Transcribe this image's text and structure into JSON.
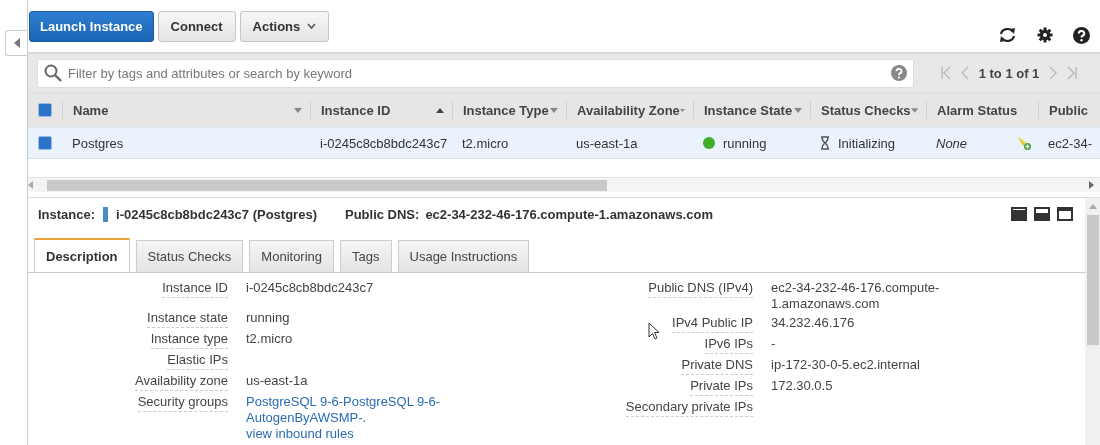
{
  "toolbar": {
    "buttons": [
      {
        "label": "Launch Instance",
        "kind": "primary"
      },
      {
        "label": "Connect",
        "kind": "default"
      },
      {
        "label": "Actions",
        "kind": "dropdown"
      }
    ]
  },
  "filter": {
    "placeholder": "Filter by tags and attributes or search by keyword"
  },
  "pager": {
    "label": "1 to 1 of 1"
  },
  "table": {
    "select_all": {
      "checked": true
    },
    "columns": [
      {
        "label": "Name",
        "kind": "menu"
      },
      {
        "label": "Instance ID",
        "kind": "asc"
      },
      {
        "label": "Instance Type",
        "kind": "menu"
      },
      {
        "label": "Availability Zone",
        "kind": "menu"
      },
      {
        "label": "Instance State",
        "kind": "menu"
      },
      {
        "label": "Status Checks",
        "kind": "menu"
      },
      {
        "label": "Alarm Status",
        "kind": "plain"
      },
      {
        "label": "Public",
        "kind": "plain"
      }
    ],
    "rows": [
      {
        "selected": true,
        "cells": [
          {
            "kind": "text",
            "text": "Postgres"
          },
          {
            "kind": "text",
            "text": "i-0245c8cb8bdc243c7"
          },
          {
            "kind": "text",
            "text": "t2.micro"
          },
          {
            "kind": "text",
            "text": "us-east-1a"
          },
          {
            "kind": "state",
            "text": "running",
            "color": "#3fae29"
          },
          {
            "kind": "status",
            "text": "Initializing"
          },
          {
            "kind": "alarm",
            "text": "None"
          },
          {
            "kind": "text",
            "text": "ec2-34-"
          }
        ]
      }
    ]
  },
  "details": {
    "instance_label": "Instance:",
    "instance_value": "i-0245c8cb8bdc243c7 (Postgres)",
    "dns_label": "Public DNS:",
    "dns_value": "ec2-34-232-46-176.compute-1.amazonaws.com",
    "tabs": [
      {
        "label": "Description",
        "selected": true
      },
      {
        "label": "Status Checks",
        "selected": false
      },
      {
        "label": "Monitoring",
        "selected": false
      },
      {
        "label": "Tags",
        "selected": false
      },
      {
        "label": "Usage Instructions",
        "selected": false
      }
    ],
    "left_fields": [
      {
        "label": "Instance ID",
        "value": "i-0245c8cb8bdc243c7",
        "kind": "text"
      },
      {
        "label": "Instance state",
        "value": "running",
        "kind": "text"
      },
      {
        "label": "Instance type",
        "value": "t2.micro",
        "kind": "text"
      },
      {
        "label": "Elastic IPs",
        "kind": "text"
      },
      {
        "label": "Availability zone",
        "value": "us-east-1a",
        "kind": "text"
      },
      {
        "label": "Security groups",
        "value": "PostgreSQL 9-6-PostgreSQL 9-6-AutogenByAWSMP-.",
        "link": "view inbound rules",
        "kind": "links"
      }
    ],
    "right_fields": [
      {
        "label": "Public DNS (IPv4)",
        "value": "ec2-34-232-46-176.compute-1.amazonaws.com",
        "kind": "text"
      },
      {
        "label": "IPv4 Public IP",
        "value": "34.232.46.176",
        "kind": "text"
      },
      {
        "label": "IPv6 IPs",
        "value": "-",
        "kind": "text"
      },
      {
        "label": "Private DNS",
        "value": "ip-172-30-0-5.ec2.internal",
        "kind": "text"
      },
      {
        "label": "Private IPs",
        "value": "172.30.0.5",
        "kind": "text"
      },
      {
        "label": "Secondary private IPs",
        "kind": "text"
      }
    ]
  }
}
